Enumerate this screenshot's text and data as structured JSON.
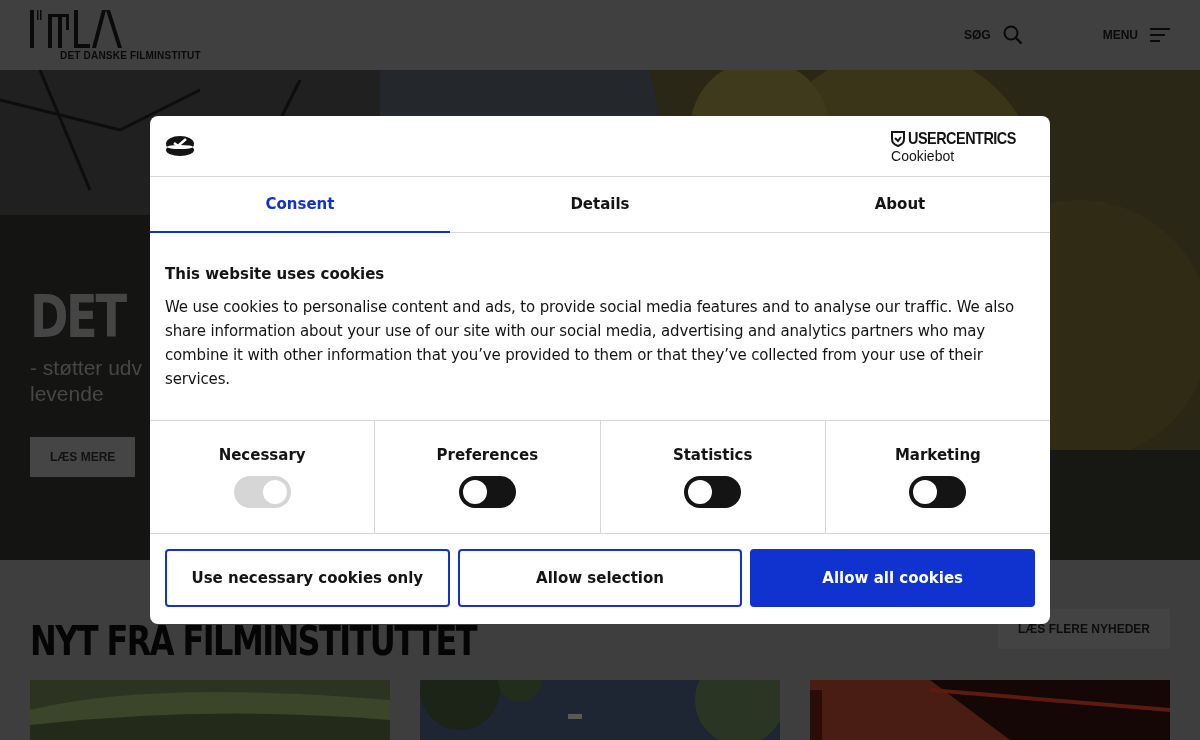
{
  "header": {
    "logo_caption": "DET DANSKE FILMINSTITUT",
    "search_label": "SØG",
    "menu_label": "MENU"
  },
  "hero": {
    "title": "DET",
    "subtitle_lines": [
      "- støtter udv",
      "levende"
    ],
    "button": "LÆS MERE"
  },
  "news": {
    "title": "NYT FRA FILMINSTITUTTET",
    "more_button": "LÆS FLERE NYHEDER"
  },
  "cookie_dialog": {
    "brand": "USERCENTRICS",
    "brand_sub": "Cookiebot",
    "tabs": [
      {
        "label": "Consent",
        "selected": true
      },
      {
        "label": "Details",
        "selected": false
      },
      {
        "label": "About",
        "selected": false
      }
    ],
    "heading": "This website uses cookies",
    "body": "We use cookies to personalise content and ads, to provide social media features and to analyse our traffic. We also share information about your use of our site with our social media, advertising and analytics partners who may combine it with other information that you’ve provided to them or that they’ve collected from your use of their services.",
    "categories": [
      {
        "label": "Necessary",
        "on": true,
        "disabled": true
      },
      {
        "label": "Preferences",
        "on": false,
        "disabled": false
      },
      {
        "label": "Statistics",
        "on": false,
        "disabled": false
      },
      {
        "label": "Marketing",
        "on": false,
        "disabled": false
      }
    ],
    "buttons": [
      {
        "label": "Use necessary cookies only",
        "kind": "outline"
      },
      {
        "label": "Allow selection",
        "kind": "outline"
      },
      {
        "label": "Allow all cookies",
        "kind": "primary"
      }
    ]
  }
}
